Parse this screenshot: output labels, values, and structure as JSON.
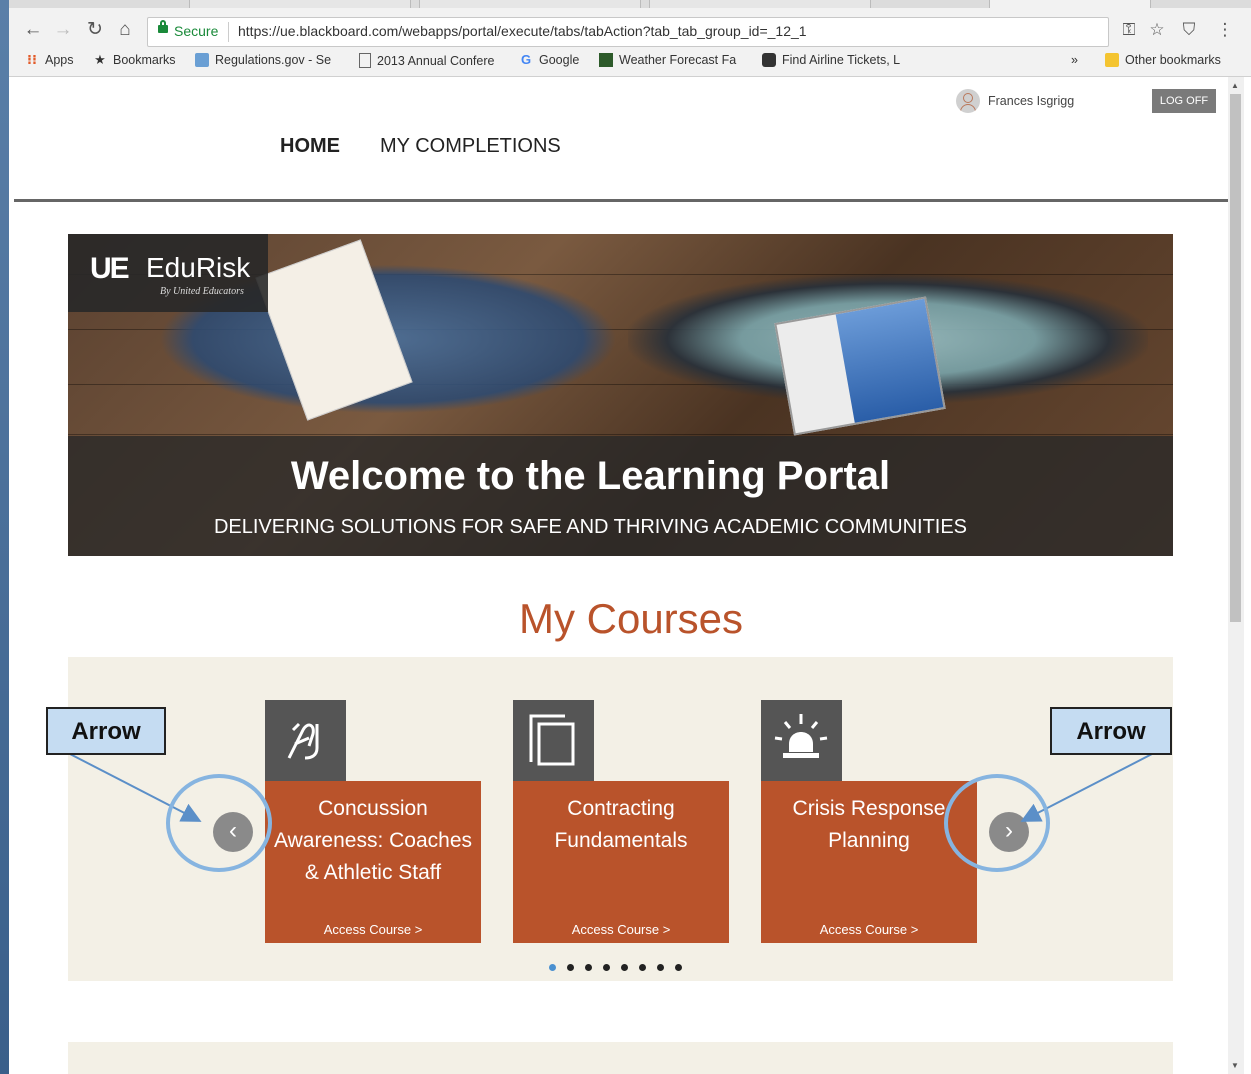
{
  "browser": {
    "security": "Secure",
    "url": "https://ue.blackboard.com/webapps/portal/execute/tabs/tabAction?tab_tab_group_id=_12_1",
    "bookmarks": [
      {
        "label": "Apps",
        "icon": "apps-grid-icon"
      },
      {
        "label": "Bookmarks",
        "icon": "star-icon"
      },
      {
        "label": "Regulations.gov - Se",
        "icon": "regulations-icon"
      },
      {
        "label": "2013 Annual Confere",
        "icon": "page-icon"
      },
      {
        "label": "Google",
        "icon": "google-icon"
      },
      {
        "label": "Weather Forecast Fa",
        "icon": "weather-icon"
      },
      {
        "label": "Find Airline Tickets, L",
        "icon": "airline-icon"
      }
    ],
    "overflow": "»",
    "other_bookmarks": "Other bookmarks"
  },
  "header": {
    "user_name": "Frances Isgrigg",
    "logoff": "LOG OFF",
    "nav": [
      "HOME",
      "MY COMPLETIONS"
    ]
  },
  "hero": {
    "brand": "EduRisk",
    "brand_mark": "UE",
    "brand_sub": "By United Educators",
    "title": "Welcome to the Learning Portal",
    "tagline": "DELIVERING SOLUTIONS FOR SAFE AND THRIVING ACADEMIC COMMUNITIES"
  },
  "courses": {
    "heading": "My Courses",
    "items": [
      {
        "title": "Concussion Awareness: Coaches & Athletic Staff",
        "action": "Access Course >",
        "icon": "concussion-icon"
      },
      {
        "title": "Contracting Fundamentals",
        "action": "Access Course >",
        "icon": "contract-pages-icon"
      },
      {
        "title": "Crisis Response Planning",
        "action": "Access Course >",
        "icon": "alarm-light-icon"
      }
    ],
    "dot_count": 8,
    "active_dot": 0
  },
  "annotations": {
    "left": "Arrow",
    "right": "Arrow"
  },
  "colors": {
    "accent": "#b9532b",
    "strip": "#f3f0e6",
    "annotation": "#c5dcf2",
    "ring": "#86b4e0"
  }
}
